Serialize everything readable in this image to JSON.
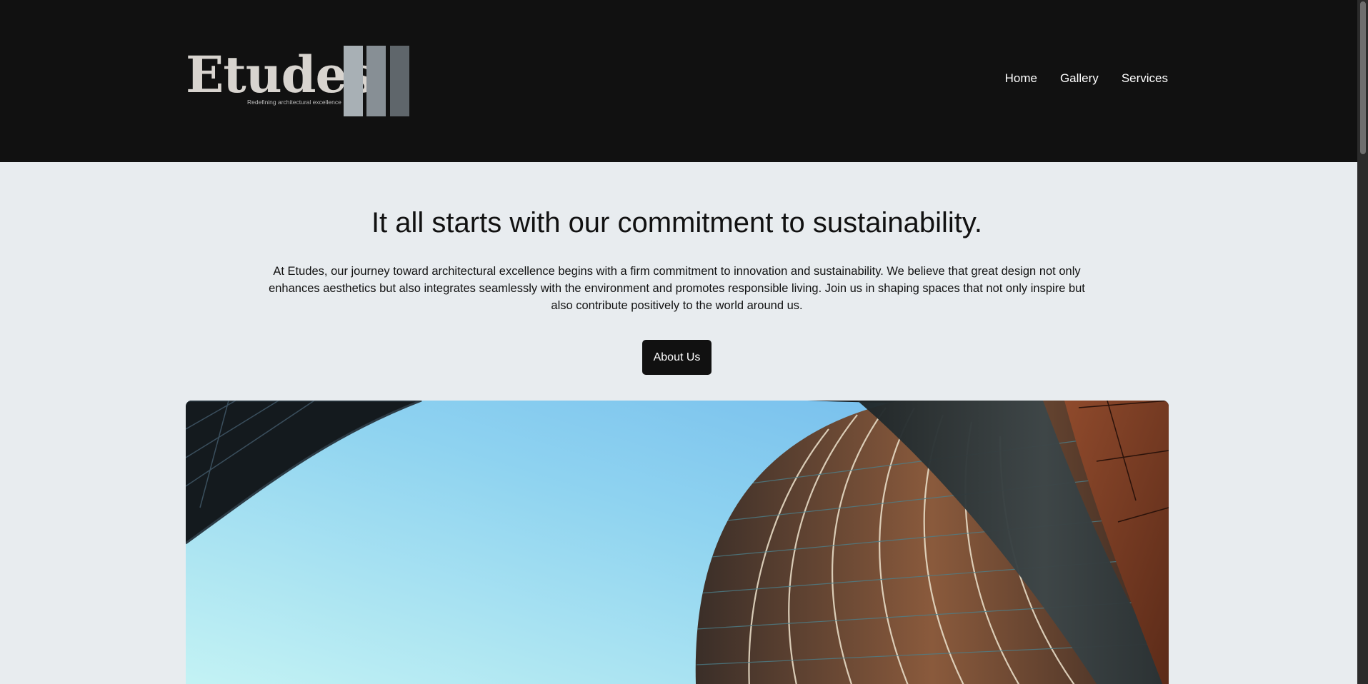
{
  "brand": {
    "name": "Etudes",
    "tagline": "Redefining architectural excellence"
  },
  "nav": {
    "items": [
      {
        "label": "Home"
      },
      {
        "label": "Gallery"
      },
      {
        "label": "Services"
      }
    ]
  },
  "hero": {
    "title": "It all starts with our commitment to sustainability.",
    "text": "At Etudes, our journey toward architectural excellence begins with a firm commitment to innovation and sustainability. We believe that great design not only enhances aesthetics but also integrates seamlessly with the environment and promotes responsible living. Join us in shaping spaces that not only inspire but also contribute positively to the world around us.",
    "button_label": "About Us"
  },
  "colors": {
    "header_bg": "#111111",
    "page_bg": "#e8ecef",
    "button_bg": "#111111",
    "sky_light": "#c6f4f4",
    "sky_dark": "#7cc1ee"
  }
}
